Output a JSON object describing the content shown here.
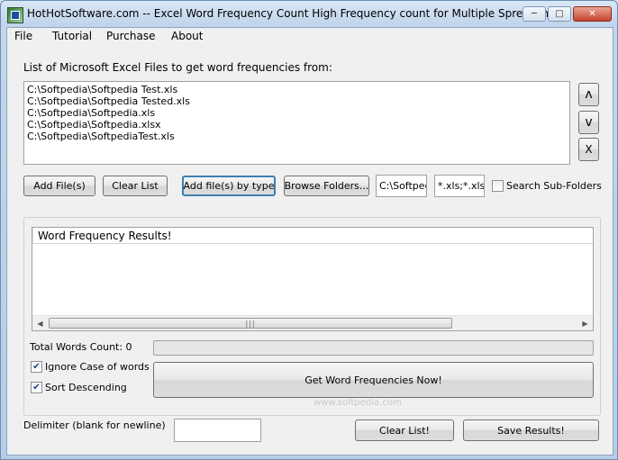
{
  "window": {
    "title": "HotHotSoftware.com -- Excel Word Frequency Count High Frequency count for Multiple Spreadsheets ...",
    "minimize": "─",
    "maximize": "□",
    "close": "✕"
  },
  "menu": {
    "file": "File",
    "tutorial": "Tutorial",
    "purchase": "Purchase",
    "about": "About"
  },
  "files": {
    "label": "List of Microsoft Excel Files to get word frequencies from:",
    "items": [
      "C:\\Softpedia\\Softpedia Test.xls",
      "C:\\Softpedia\\Softpedia Tested.xls",
      "C:\\Softpedia\\Softpedia.xls",
      "C:\\Softpedia\\Softpedia.xlsx",
      "C:\\Softpedia\\SoftpediaTest.xls"
    ],
    "move_up": "ʌ",
    "move_down": "v",
    "remove": "X"
  },
  "toolbar": {
    "add_files": "Add File(s)",
    "clear_list": "Clear List",
    "add_by_type": "Add file(s) by type",
    "browse_folders": "Browse Folders...",
    "folder_value": "C:\\Softpec",
    "type_value": "*.xls;*.xlsx",
    "search_subfolders": "Search Sub-Folders",
    "search_subfolders_checked": false
  },
  "results": {
    "column_header": "Word Frequency Results!",
    "total_words_label": "Total Words Count: 0",
    "progress": 0,
    "ignore_case_label": "Ignore Case of words",
    "ignore_case_checked": true,
    "sort_desc_label": "Sort Descending",
    "sort_desc_checked": true,
    "get_frequencies": "Get Word Frequencies Now!",
    "scroll_grip": "|||"
  },
  "footer": {
    "delimiter_label": "Delimiter (blank for newline)",
    "delimiter_value": "",
    "clear_list": "Clear List!",
    "save_results": "Save Results!"
  },
  "watermark": "www.softpedia.com"
}
